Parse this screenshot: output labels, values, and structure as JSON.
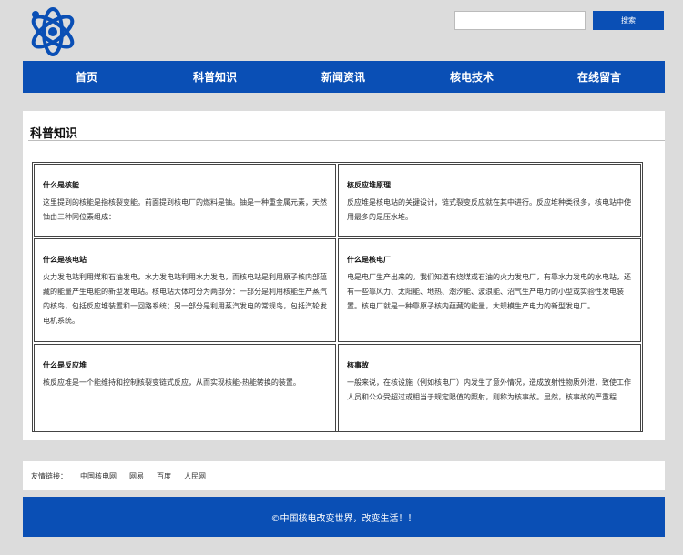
{
  "header": {
    "logo_icon": "atom-logo-icon",
    "search_placeholder": "",
    "search_button": "搜索"
  },
  "nav": {
    "items": [
      "首页",
      "科普知识",
      "新闻资讯",
      "核电技术",
      "在线留言"
    ]
  },
  "main": {
    "title": "科普知识",
    "cells": [
      {
        "title": "什么是核能",
        "text": "这里提到的核能是指核裂变能。前面提到核电厂的燃料是铀。铀是一种重金属元素，天然铀由三种同位素组成："
      },
      {
        "title": "核反应堆原理",
        "text": "反应堆是核电站的关键设计，链式裂变反应就在其中进行。反应堆种类很多，核电站中使用最多的是压水堆。"
      },
      {
        "title": "什么是核电站",
        "text": "火力发电站利用煤和石油发电，水力发电站利用水力发电，而核电站是利用原子核内部蕴藏的能量产生电能的新型发电站。核电站大体可分为两部分：一部分是利用核能生产蒸汽的核岛，包括反应堆装置和一回路系统；另一部分是利用蒸汽发电的常规岛，包括汽轮发电机系统。"
      },
      {
        "title": "什么是核电厂",
        "text": "电是电厂生产出来的。我们知道有烧煤或石油的火力发电厂，有靠水力发电的水电站，还有一些靠风力、太阳能、地热、潮汐能、波浪能、沼气生产电力的小型或实验性发电装置。核电厂就是一种靠原子核内蕴藏的能量，大规模生产电力的新型发电厂。"
      },
      {
        "title": "什么是反应堆",
        "text": "核反应堆是一个能维持和控制核裂变链式反应，从而实现核能-热能转换的装置。"
      },
      {
        "title": "核事故",
        "text": "一般来说，在核设施（例如核电厂）内发生了意外情况，造成放射性物质外泄，致使工作人员和公众受超过或相当于规定限值的照射，则称为核事故。显然，核事故的严重程"
      }
    ]
  },
  "links": {
    "label": "友情链接：",
    "items": [
      "中国核电网",
      "网易",
      "百度",
      "人民网"
    ]
  },
  "footer": {
    "text": "©中国核电改变世界，改变生活！！"
  },
  "colors": {
    "brand_blue": "#0a4fb5",
    "page_background": "#dcdcdc"
  }
}
